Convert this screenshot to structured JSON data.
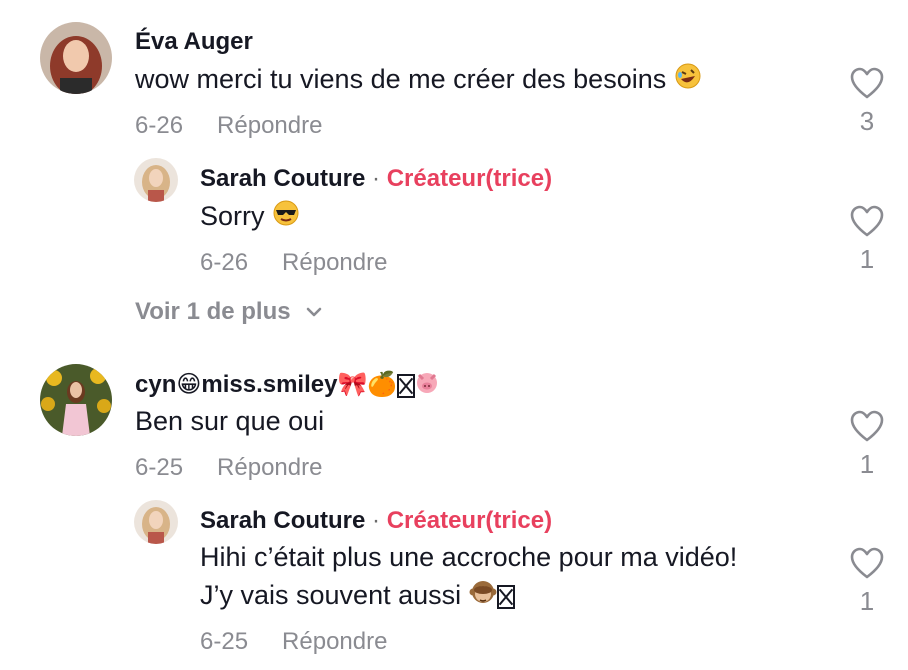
{
  "comments": [
    {
      "username": "Éva Auger",
      "text": "wow merci tu viens de me créer des besoins",
      "text_emoji": "rolling-on-floor-laughing-emoji",
      "date": "6-26",
      "reply_label": "Répondre",
      "likes": "3",
      "replies": [
        {
          "username": "Sarah Couture",
          "separator": "·",
          "creator_label": "Créateur(trice)",
          "text": "Sorry",
          "text_emoji": "sunglasses-face-emoji",
          "date": "6-26",
          "reply_label": "Répondre",
          "likes": "1"
        }
      ],
      "view_more_label": "Voir 1 de plus"
    },
    {
      "username": "cyn😁miss.smiley🎀🍊",
      "username_suffix_emoji": "pig-face-emoji",
      "text": "Ben sur que oui",
      "date": "6-25",
      "reply_label": "Répondre",
      "likes": "1",
      "replies": [
        {
          "username": "Sarah Couture",
          "separator": "·",
          "creator_label": "Créateur(trice)",
          "text_line1": "Hihi c’était plus une accroche pour ma vidéo!",
          "text_line2": "J’y vais souvent aussi",
          "text_emoji": "see-no-evil-monkey-emoji",
          "date": "6-25",
          "reply_label": "Répondre",
          "likes": "1"
        }
      ]
    }
  ],
  "colors": {
    "creator_accent": "#e8405e",
    "muted": "#8a8b91",
    "text": "#161823"
  },
  "icons": {
    "like": "heart-outline-icon",
    "expand": "chevron-down-icon"
  }
}
